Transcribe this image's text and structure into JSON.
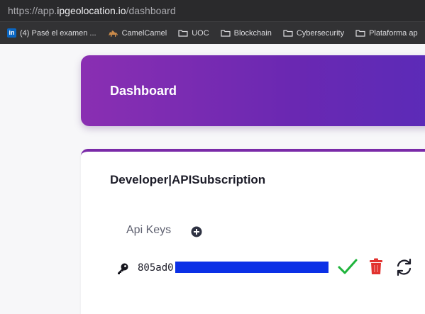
{
  "browser": {
    "url_prefix": "https://app.",
    "url_host": "ipgeolocation.io",
    "url_path": "/dashboard",
    "bookmarks": [
      {
        "label": "(4) Pasé el examen ...",
        "icon": "linkedin-icon"
      },
      {
        "label": "CamelCamel",
        "icon": "camel-icon"
      },
      {
        "label": "UOC",
        "icon": "folder-icon"
      },
      {
        "label": "Blockchain",
        "icon": "folder-icon"
      },
      {
        "label": "Cybersecurity",
        "icon": "folder-icon"
      },
      {
        "label": "Plataforma ap",
        "icon": "folder-icon"
      }
    ]
  },
  "header": {
    "title": "Dashboard"
  },
  "subscription": {
    "title": "Developer|APISubscription",
    "api_keys_label": "Api Keys",
    "keys": [
      {
        "visible_prefix": "805ad0"
      }
    ]
  },
  "colors": {
    "accent": "#7a2aa8",
    "check": "#1fb43c",
    "trash": "#e2322f",
    "redaction": "#0b30e6"
  }
}
